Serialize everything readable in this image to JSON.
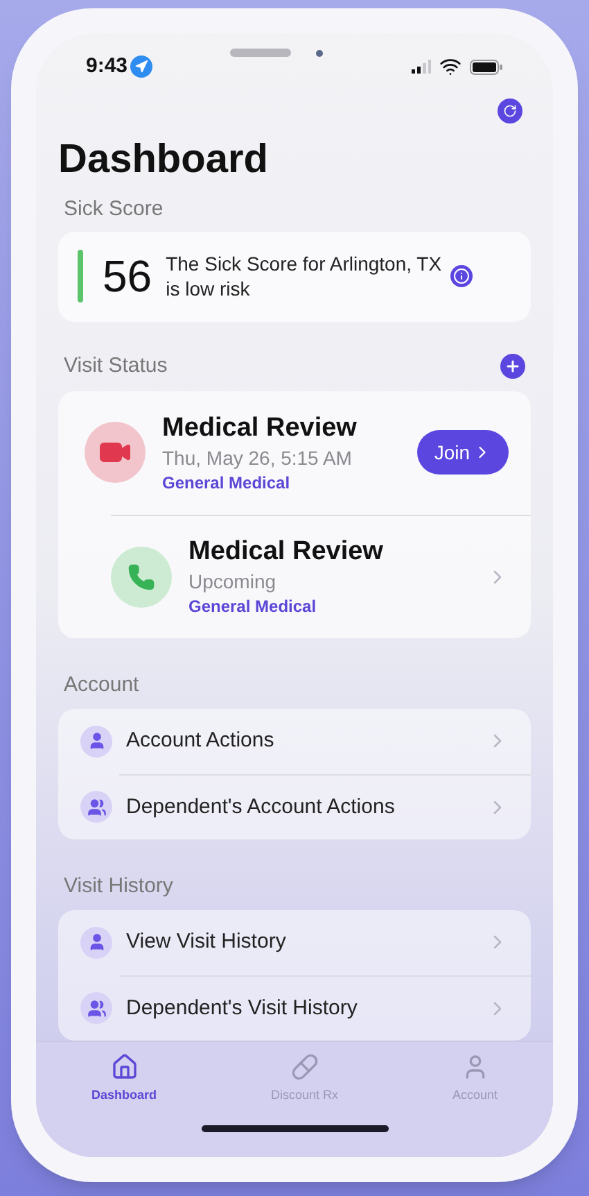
{
  "status_bar": {
    "time": "9:43"
  },
  "title": "Dashboard",
  "sick_score": {
    "heading": "Sick Score",
    "score": "56",
    "message": "The Sick Score for Arlington, TX is low risk"
  },
  "visit_status": {
    "heading": "Visit Status",
    "visits": [
      {
        "kind": "video",
        "title": "Medical Review",
        "subtitle": "Thu, May 26, 5:15 AM",
        "category": "General Medical",
        "action": "Join"
      },
      {
        "kind": "phone",
        "title": "Medical Review",
        "subtitle": "Upcoming",
        "category": "General Medical"
      }
    ]
  },
  "sections": [
    {
      "heading": "Account",
      "items": [
        {
          "kind": "single",
          "label": "Account Actions"
        },
        {
          "kind": "group",
          "label": "Dependent's Account Actions"
        }
      ]
    },
    {
      "heading": "Visit History",
      "items": [
        {
          "kind": "single",
          "label": "View Visit History"
        },
        {
          "kind": "group",
          "label": "Dependent's Visit History"
        }
      ]
    }
  ],
  "tabs": [
    {
      "kind": "home",
      "label": "Dashboard",
      "selected": true
    },
    {
      "kind": "pills",
      "label": "Discount Rx",
      "selected": false
    },
    {
      "kind": "person",
      "label": "Account",
      "selected": false
    }
  ]
}
